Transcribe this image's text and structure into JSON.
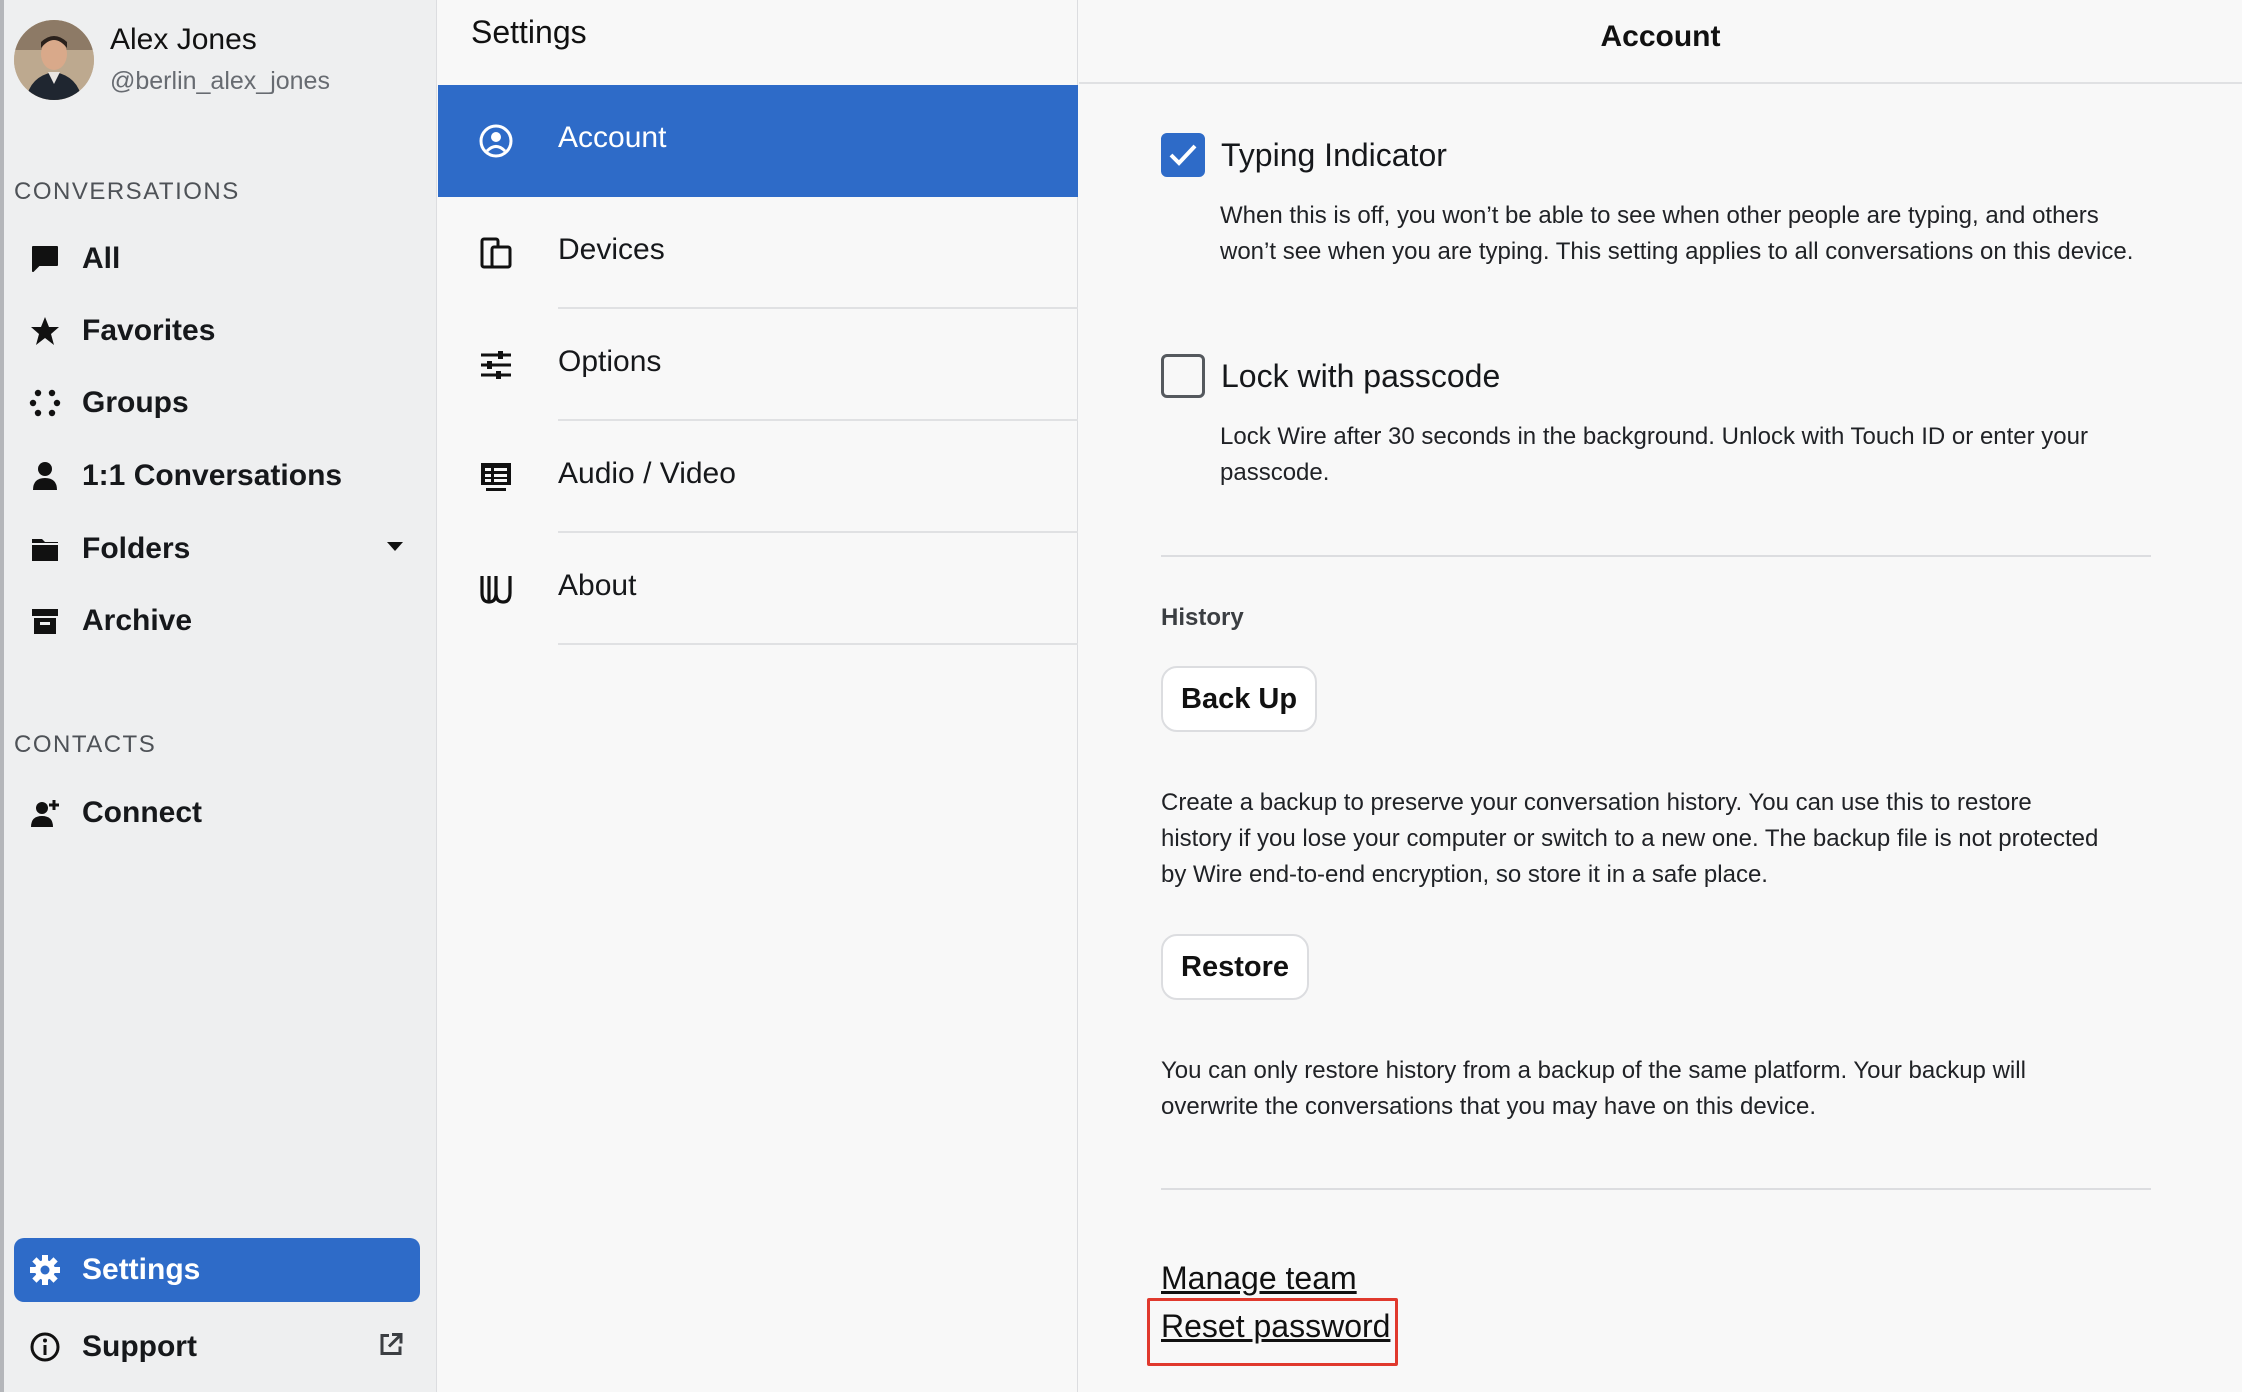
{
  "user": {
    "name": "Alex Jones",
    "handle": "@berlin_alex_jones"
  },
  "sidebar": {
    "conversations_title": "CONVERSATIONS",
    "items": [
      {
        "label": "All",
        "icon": "chat-bubble-icon"
      },
      {
        "label": "Favorites",
        "icon": "star-icon"
      },
      {
        "label": "Groups",
        "icon": "groups-dots-icon"
      },
      {
        "label": "1:1 Conversations",
        "icon": "person-icon"
      },
      {
        "label": "Folders",
        "icon": "folder-icon"
      },
      {
        "label": "Archive",
        "icon": "archive-icon"
      }
    ],
    "contacts_title": "CONTACTS",
    "connect_label": "Connect",
    "settings_label": "Settings",
    "support_label": "Support"
  },
  "settings_menu": {
    "title": "Settings",
    "items": [
      {
        "label": "Account",
        "icon": "account-circle-icon",
        "active": true
      },
      {
        "label": "Devices",
        "icon": "devices-icon"
      },
      {
        "label": "Options",
        "icon": "sliders-icon"
      },
      {
        "label": "Audio / Video",
        "icon": "audio-video-icon"
      },
      {
        "label": "About",
        "icon": "wire-logo-icon"
      }
    ]
  },
  "account": {
    "header": "Account",
    "typing_indicator": {
      "label": "Typing Indicator",
      "checked": true,
      "description": "When this is off, you won’t be able to see when other people are typing, and others won’t see when you are typing. This setting applies to all conversations on this device."
    },
    "lock_passcode": {
      "label": "Lock with passcode",
      "checked": false,
      "description": "Lock Wire after 30 seconds in the background. Unlock with Touch ID or enter your passcode."
    },
    "history": {
      "title": "History",
      "backup_button": "Back Up",
      "backup_description": "Create a backup to preserve your conversation history. You can use this to restore history if you lose your computer or switch to a new one. The backup file is not protected by Wire end-to-end encryption, so store it in a safe place.",
      "restore_button": "Restore",
      "restore_description": "You can only restore history from a backup of the same platform. Your backup will overwrite the conversations that you may have on this device."
    },
    "links": {
      "manage_team": "Manage team",
      "reset_password": "Reset password"
    }
  },
  "colors": {
    "accent": "#2e6bc8",
    "highlight": "#e0392d"
  }
}
